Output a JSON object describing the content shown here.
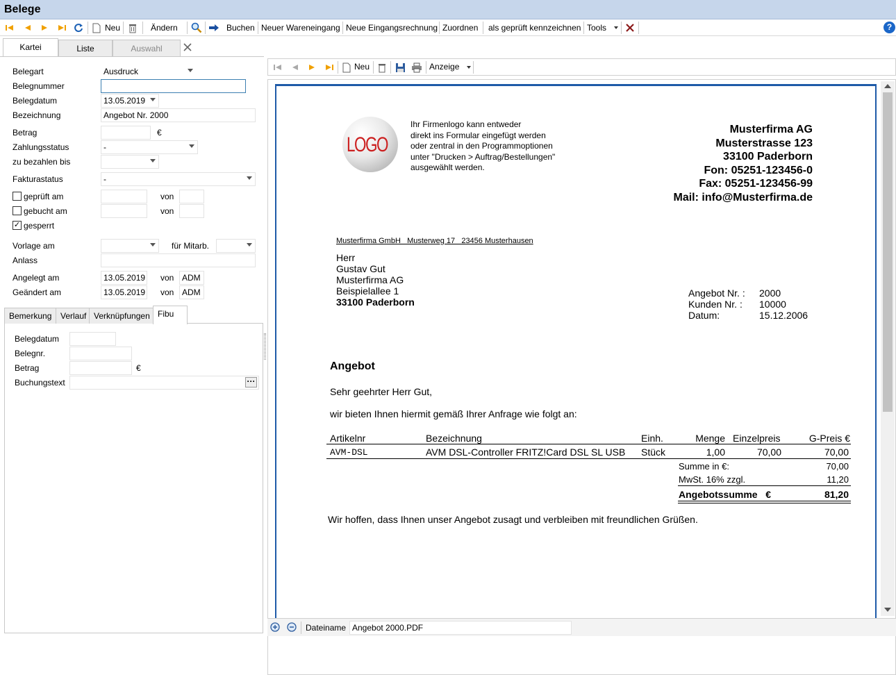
{
  "window": {
    "title": "Belege"
  },
  "toolbar": {
    "new_label": "Neu",
    "edit_label": "Ändern",
    "book_label": "Buchen",
    "goods_receipt_label": "Neuer Wareneingang",
    "incoming_invoice_label": "Neue Eingangsrechnung",
    "assign_label": "Zuordnen",
    "mark_checked_label": "als geprüft kennzeichnen",
    "tools_label": "Tools",
    "help_label": "?"
  },
  "main_tabs": [
    "Kartei",
    "Liste",
    "Auswahl"
  ],
  "form": {
    "belegart": {
      "label": "Belegart",
      "value": "Ausdruck"
    },
    "belegnummer": {
      "label": "Belegnummer",
      "value": ""
    },
    "belegdatum": {
      "label": "Belegdatum",
      "value": "13.05.2019"
    },
    "bezeichnung": {
      "label": "Bezeichnung",
      "value": "Angebot Nr. 2000"
    },
    "betrag": {
      "label": "Betrag",
      "value": "",
      "unit": "€"
    },
    "zahlungsstatus": {
      "label": "Zahlungsstatus",
      "value": "-"
    },
    "zu_bezahlen_bis": {
      "label": "zu bezahlen bis",
      "value": ""
    },
    "fakturastatus": {
      "label": "Fakturastatus",
      "value": "-"
    },
    "geprueft": {
      "label": "geprüft am",
      "checked": false,
      "von_label": "von"
    },
    "gebucht": {
      "label": "gebucht am",
      "checked": false,
      "von_label": "von"
    },
    "gesperrt": {
      "label": "gesperrt",
      "checked": true
    },
    "vorlage": {
      "label": "Vorlage am",
      "mitarb_label": "für Mitarb."
    },
    "anlass": {
      "label": "Anlass",
      "value": ""
    },
    "angelegt": {
      "label": "Angelegt am",
      "date": "13.05.2019",
      "von_label": "von",
      "user": "ADM"
    },
    "geaendert": {
      "label": "Geändert am",
      "date": "13.05.2019",
      "von_label": "von",
      "user": "ADM"
    }
  },
  "sub_tabs": [
    "Bemerkung",
    "Verlauf",
    "Verknüpfungen",
    "Fibu"
  ],
  "fibu": {
    "belegdatum_label": "Belegdatum",
    "belegnr_label": "Belegnr.",
    "betrag_label": "Betrag",
    "betrag_unit": "€",
    "buchungstext_label": "Buchungstext",
    "more_label": "···"
  },
  "viewer": {
    "new_label": "Neu",
    "display_label": "Anzeige",
    "filename_label": "Dateiname",
    "filename_value": "Angebot 2000.PDF"
  },
  "document": {
    "logo_text": "LOGO",
    "logo_note": [
      "Ihr Firmenlogo kann entweder",
      "direkt ins Formular eingefügt werden",
      "oder zentral in den Programmoptionen",
      "unter \"Drucken > Auftrag/Bestellungen\"",
      "ausgewählt werden."
    ],
    "company": [
      "Musterfirma AG",
      "Musterstrasse 123",
      "33100 Paderborn",
      "Fon: 05251-123456-0",
      "Fax: 05251-123456-99",
      "Mail: info@Musterfirma.de"
    ],
    "sender_line": "Musterfirma GmbH   Musterweg 17   23456 Musterhausen",
    "recipient": [
      "Herr",
      "Gustav Gut",
      "Musterfirma AG",
      "Beispielallee 1",
      "33100 Paderborn"
    ],
    "meta": [
      {
        "label": "Angebot Nr. :",
        "value": "2000"
      },
      {
        "label": "Kunden Nr. :",
        "value": "10000"
      },
      {
        "label": "Datum:",
        "value": "15.12.2006"
      }
    ],
    "heading": "Angebot",
    "salutation": "Sehr geehrter Herr Gut,",
    "intro": "wir bieten Ihnen hiermit gemäß Ihrer Anfrage wie folgt an:",
    "table_headers": [
      "Artikelnr",
      "Bezeichnung",
      "Einh.",
      "Menge",
      "Einzelpreis",
      "G-Preis €"
    ],
    "table_row": [
      "AVM-DSL",
      "AVM DSL-Controller FRITZ!Card DSL SL USB",
      "Stück",
      "1,00",
      "70,00",
      "70,00"
    ],
    "sum_label": "Summe in €:",
    "sum_value": "70,00",
    "vat_label": "MwSt. 16% zzgl.",
    "vat_value": "11,20",
    "total_label": "Angebotssumme   €",
    "total_value": "81,20",
    "closing": "Wir hoffen, dass Ihnen unser Angebot zusagt und verbleiben mit freundlichen Grüßen."
  },
  "colors": {
    "titlebar": "#c6d6eb",
    "accent": "#1e5aa8",
    "nav_orange": "#f0a000"
  }
}
